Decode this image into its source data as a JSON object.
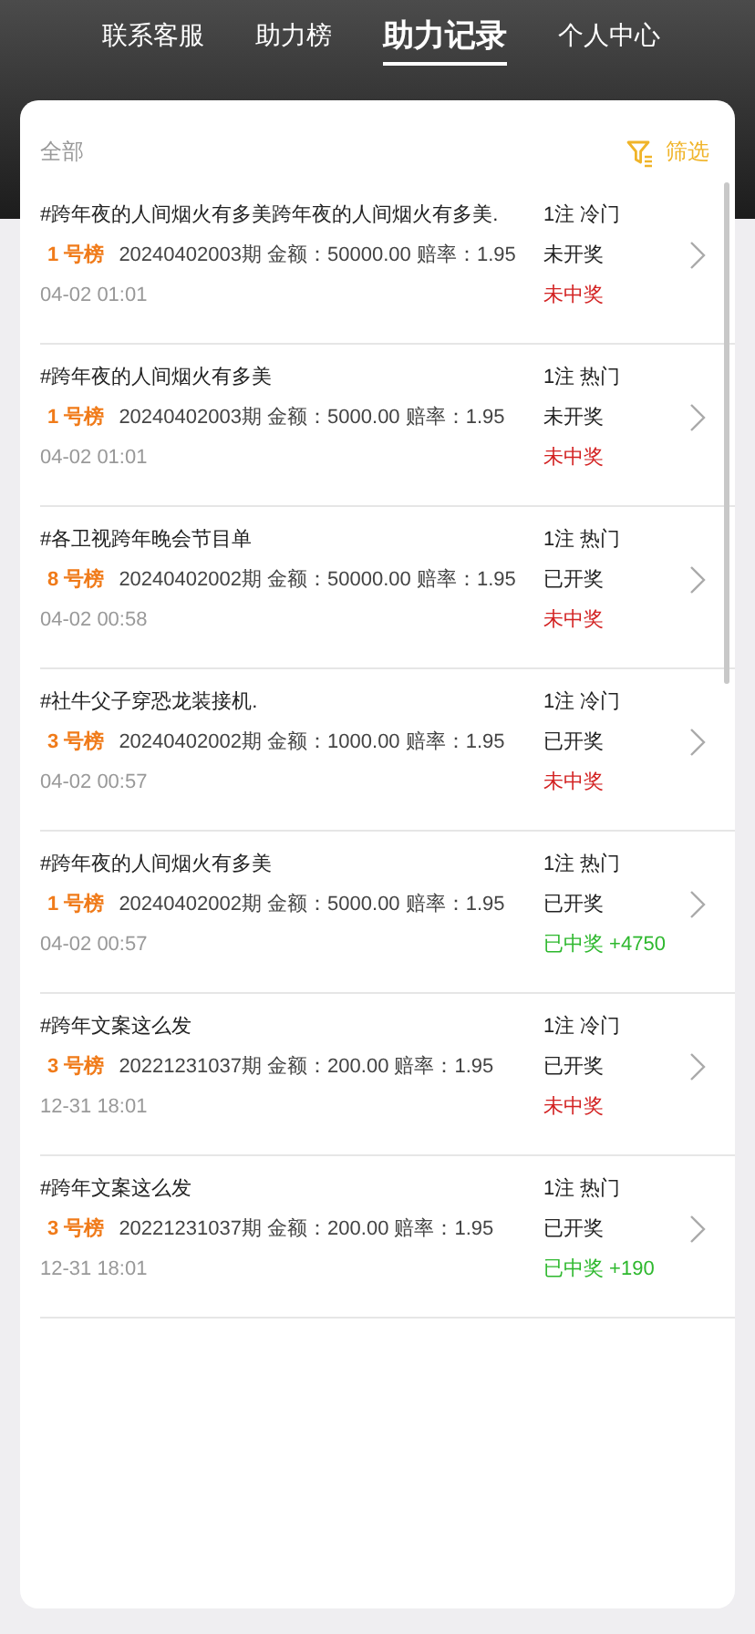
{
  "tabs": [
    {
      "label": "联系客服",
      "selected": false
    },
    {
      "label": "助力榜",
      "selected": false
    },
    {
      "label": "助力记录",
      "selected": true
    },
    {
      "label": "个人中心",
      "selected": false
    }
  ],
  "filter": {
    "scope": "全部",
    "button": "筛选"
  },
  "records": [
    {
      "title": "#跨年夜的人间烟火有多美跨年夜的人间烟火有多美.",
      "tag": "1注 冷门",
      "board": "1 号榜",
      "detail": "20240402003期 金额：50000.00 赔率：1.95",
      "status": "未开奖",
      "time": "04-02 01:01",
      "result": "未中奖",
      "won": false
    },
    {
      "title": "#跨年夜的人间烟火有多美",
      "tag": "1注 热门",
      "board": "1 号榜",
      "detail": "20240402003期 金额：5000.00 赔率：1.95",
      "status": "未开奖",
      "time": "04-02 01:01",
      "result": "未中奖",
      "won": false
    },
    {
      "title": "#各卫视跨年晚会节目单",
      "tag": "1注 热门",
      "board": "8 号榜",
      "detail": "20240402002期 金额：50000.00 赔率：1.95",
      "status": "已开奖",
      "time": "04-02 00:58",
      "result": "未中奖",
      "won": false
    },
    {
      "title": "#社牛父子穿恐龙装接机.",
      "tag": "1注 冷门",
      "board": "3 号榜",
      "detail": "20240402002期 金额：1000.00 赔率：1.95",
      "status": "已开奖",
      "time": "04-02 00:57",
      "result": "未中奖",
      "won": false
    },
    {
      "title": "#跨年夜的人间烟火有多美",
      "tag": "1注 热门",
      "board": "1 号榜",
      "detail": "20240402002期 金额：5000.00 赔率：1.95",
      "status": "已开奖",
      "time": "04-02 00:57",
      "result": "已中奖 +4750",
      "won": true
    },
    {
      "title": "#跨年文案这么发",
      "tag": "1注 冷门",
      "board": "3 号榜",
      "detail": "20221231037期 金额：200.00 赔率：1.95",
      "status": "已开奖",
      "time": "12-31 18:01",
      "result": "未中奖",
      "won": false
    },
    {
      "title": "#跨年文案这么发",
      "tag": "1注 热门",
      "board": "3 号榜",
      "detail": "20221231037期 金额：200.00 赔率：1.95",
      "status": "已开奖",
      "time": "12-31 18:01",
      "result": "已中奖 +190",
      "won": true
    }
  ]
}
